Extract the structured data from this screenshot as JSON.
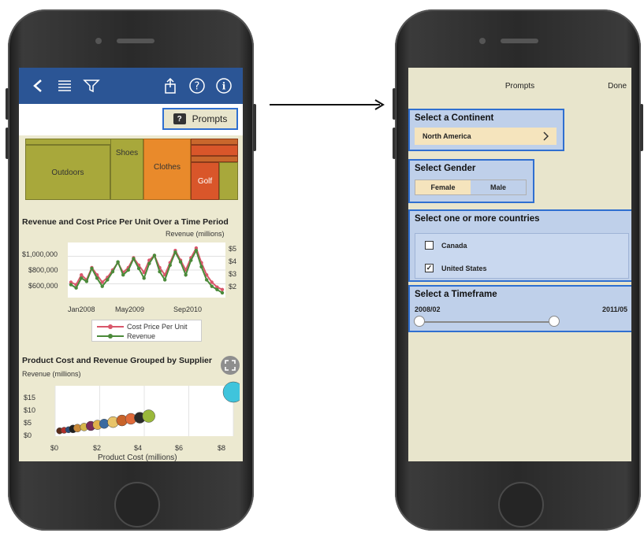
{
  "left_screen": {
    "prompts_button_label": "Prompts",
    "treemap": {
      "labels": [
        "Outdoors",
        "Shoes",
        "Clothes",
        "Golf"
      ],
      "colors": {
        "green": "#a8a83b",
        "orange": "#e98a2b",
        "red": "#d9562a",
        "dark_orange": "#c9672c"
      }
    },
    "chart1": {
      "title": "Revenue and Cost Price Per Unit Over a Time Period",
      "secondary_axis_label": "Revenue (millions)",
      "left_ticks": [
        "$1,000,000",
        "$800,000",
        "$600,000"
      ],
      "right_ticks": [
        "$5",
        "$4",
        "$3",
        "$2"
      ],
      "x_ticks": [
        "Jan2008",
        "May2009",
        "Sep2010"
      ],
      "legend": [
        "Cost Price Per Unit",
        "Revenue"
      ]
    },
    "chart2": {
      "title": "Product Cost and Revenue Grouped by Supplier",
      "y_axis_label": "Revenue (millions)",
      "y_ticks": [
        "$15",
        "$10",
        "$5",
        "$0"
      ],
      "x_ticks": [
        "$0",
        "$2",
        "$4",
        "$6",
        "$8"
      ],
      "x_axis_label": "Product Cost (millions)"
    }
  },
  "right_screen": {
    "header_title": "Prompts",
    "done_label": "Done",
    "continent": {
      "title": "Select a Continent",
      "value": "North America"
    },
    "gender": {
      "title": "Select Gender",
      "options": [
        "Female",
        "Male"
      ],
      "selected": "Male"
    },
    "countries": {
      "title": "Select one or more countries",
      "items": [
        {
          "label": "Canada",
          "checked": false
        },
        {
          "label": "United States",
          "checked": true
        }
      ]
    },
    "timeframe": {
      "title": "Select a Timeframe",
      "start": "2008/02",
      "end": "2011/05"
    }
  },
  "chart_data": [
    {
      "type": "line",
      "title": "Revenue and Cost Price Per Unit Over a Time Period",
      "x_ticks": [
        "Jan2008",
        "May2009",
        "Sep2010"
      ],
      "ylabel_right": "Revenue (millions)",
      "ylim_left": [
        600000,
        1000000
      ],
      "ylim_right": [
        2,
        5
      ],
      "series": [
        {
          "name": "Cost Price Per Unit",
          "color": "#d9576b",
          "values": [
            700000,
            680000,
            760000,
            720000,
            820000,
            760000,
            700000,
            740000,
            800000,
            860000,
            780000,
            820000,
            900000,
            840000,
            780000,
            880000,
            920000,
            820000,
            760000,
            860000,
            960000,
            880000,
            800000,
            900000,
            980000,
            860000,
            760000,
            700000,
            660000,
            640000
          ]
        },
        {
          "name": "Revenue",
          "color": "#4b8a3a",
          "values": [
            2.6,
            2.4,
            3.0,
            2.8,
            3.6,
            3.0,
            2.5,
            2.9,
            3.4,
            4.0,
            3.2,
            3.5,
            4.2,
            3.6,
            3.0,
            3.9,
            4.4,
            3.4,
            2.9,
            3.8,
            4.6,
            4.0,
            3.2,
            4.1,
            4.7,
            3.7,
            2.9,
            2.5,
            2.3,
            2.1
          ]
        }
      ]
    },
    {
      "type": "scatter",
      "title": "Product Cost and Revenue Grouped by Supplier",
      "xlabel": "Product Cost (millions)",
      "ylabel": "Revenue (millions)",
      "xlim": [
        0,
        8
      ],
      "ylim": [
        0,
        15
      ],
      "points": [
        {
          "x": 0.2,
          "y": 0.8,
          "r": 4,
          "color": "#5a2d1a"
        },
        {
          "x": 0.4,
          "y": 1.0,
          "r": 4,
          "color": "#b0302a"
        },
        {
          "x": 0.6,
          "y": 1.2,
          "r": 4,
          "color": "#2a4d7a"
        },
        {
          "x": 0.8,
          "y": 1.5,
          "r": 5,
          "color": "#1f1f1f"
        },
        {
          "x": 1.0,
          "y": 1.8,
          "r": 5,
          "color": "#c98a3a"
        },
        {
          "x": 1.3,
          "y": 2.2,
          "r": 5,
          "color": "#d6b54a"
        },
        {
          "x": 1.6,
          "y": 2.6,
          "r": 6,
          "color": "#7a2a5a"
        },
        {
          "x": 1.9,
          "y": 3.0,
          "r": 6,
          "color": "#e0b04a"
        },
        {
          "x": 2.2,
          "y": 3.4,
          "r": 6,
          "color": "#3a6aa0"
        },
        {
          "x": 2.6,
          "y": 4.0,
          "r": 7,
          "color": "#e8c46a"
        },
        {
          "x": 3.0,
          "y": 4.6,
          "r": 7,
          "color": "#c8632a"
        },
        {
          "x": 3.4,
          "y": 5.2,
          "r": 7,
          "color": "#e06a3a"
        },
        {
          "x": 3.8,
          "y": 5.6,
          "r": 7,
          "color": "#2a2a2a"
        },
        {
          "x": 4.2,
          "y": 6.2,
          "r": 8,
          "color": "#9ab83a"
        },
        {
          "x": 8.0,
          "y": 15.0,
          "r": 13,
          "color": "#3fc4dc"
        }
      ]
    }
  ]
}
